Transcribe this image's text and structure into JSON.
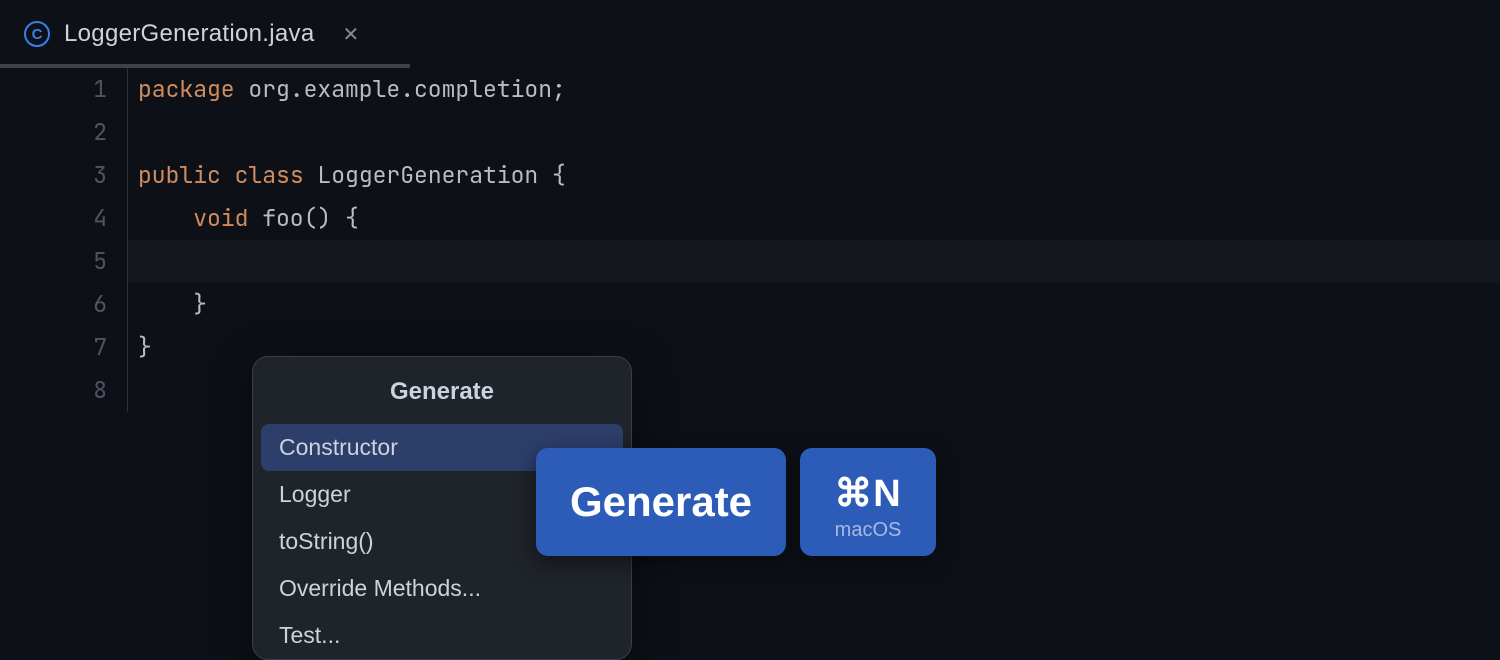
{
  "tab": {
    "filename": "LoggerGeneration.java",
    "icon_letter": "C"
  },
  "code": {
    "line1_kw": "package",
    "line1_pkg": " org.example.completion;",
    "line3_kw1": "public",
    "line3_kw2": " class",
    "line3_cls": " LoggerGeneration ",
    "line3_brace": "{",
    "line4_indent": "    ",
    "line4_kw": "void",
    "line4_id": " foo",
    "line4_rest": "() {",
    "line6": "    }",
    "line7": "}"
  },
  "gutter": [
    "1",
    "2",
    "3",
    "4",
    "5",
    "6",
    "7",
    "8"
  ],
  "popup": {
    "title": "Generate",
    "items": [
      "Constructor",
      "Logger",
      "toString()",
      "Override Methods...",
      "Test..."
    ]
  },
  "badge_generate": "Generate",
  "badge_shortcut": "⌘N",
  "badge_shortcut_os": "macOS"
}
